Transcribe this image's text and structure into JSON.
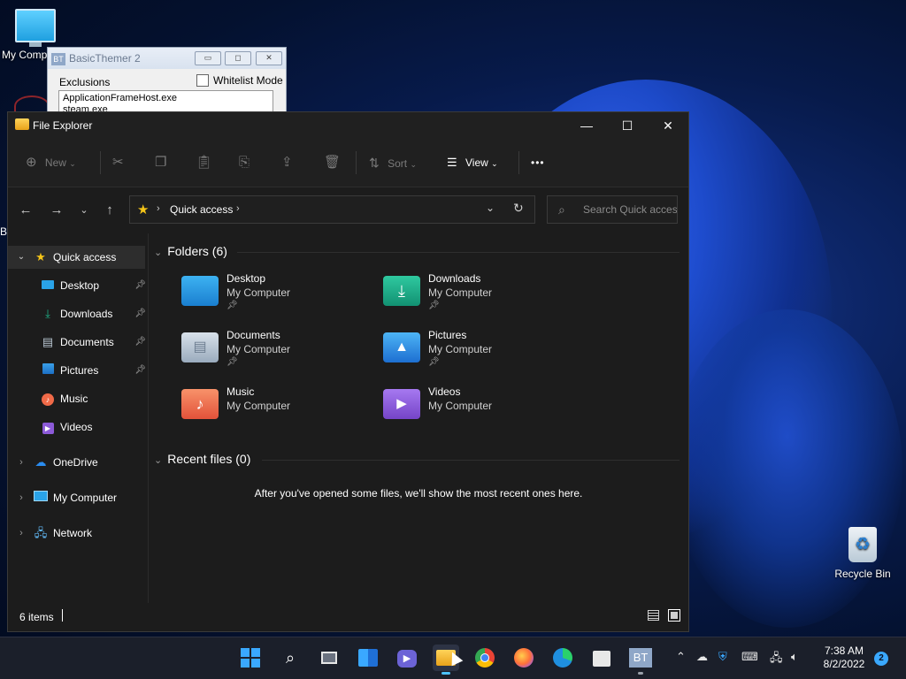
{
  "desktop": {
    "my_computer_label": "My Comp",
    "recycle_bin_label": "Recycle Bin",
    "stray_letter": "B"
  },
  "basic_themer": {
    "title": "BasicThemer 2",
    "icon_text": "BT",
    "exclusions_label": "Exclusions",
    "whitelist_label": "Whitelist Mode",
    "exclusions_list": [
      "ApplicationFrameHost.exe",
      "steam.exe"
    ]
  },
  "explorer": {
    "title": "File Explorer",
    "toolbar": {
      "new_label": "New",
      "sort_label": "Sort",
      "view_label": "View",
      "more_label": "•••"
    },
    "address": {
      "path_label": "Quick access",
      "search_placeholder": "Search Quick access"
    },
    "sidebar": {
      "quick_access": "Quick access",
      "pinned": [
        {
          "label": "Desktop"
        },
        {
          "label": "Downloads"
        },
        {
          "label": "Documents"
        },
        {
          "label": "Pictures"
        },
        {
          "label": "Music"
        },
        {
          "label": "Videos"
        }
      ],
      "onedrive": "OneDrive",
      "my_computer": "My Computer",
      "network": "Network"
    },
    "folders_header": "Folders (6)",
    "folders": [
      {
        "name": "Desktop",
        "location": "My Computer",
        "pinned": true
      },
      {
        "name": "Downloads",
        "location": "My Computer",
        "pinned": true
      },
      {
        "name": "Documents",
        "location": "My Computer",
        "pinned": true
      },
      {
        "name": "Pictures",
        "location": "My Computer",
        "pinned": true
      },
      {
        "name": "Music",
        "location": "My Computer",
        "pinned": false
      },
      {
        "name": "Videos",
        "location": "My Computer",
        "pinned": false
      }
    ],
    "recent_header": "Recent files (0)",
    "recent_empty_message": "After you've opened some files, we'll show the most recent ones here.",
    "status_items": "6 items"
  },
  "taskbar": {
    "time": "7:38 AM",
    "date": "8/2/2022",
    "notification_count": "2",
    "bt_label": "BT"
  },
  "colors": {
    "accent": "#0078d4",
    "folder_blue": "#3aa0e8",
    "downloads_green": "#1fb38a",
    "music_orange": "#f06a48",
    "videos_purple": "#8c5ad8"
  }
}
